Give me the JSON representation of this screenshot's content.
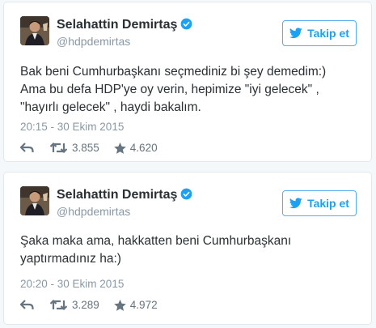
{
  "tweets": [
    {
      "name": "Selahattin Demirtaş",
      "handle": "@hdpdemirtas",
      "follow_label": "Takip et",
      "text": "Bak beni Cumhurbaşkanı seçmediniz bi şey demedim:)\nAma bu defa HDP'ye oy verin, hepimize \"iyi gelecek\" ,\n\"hayırlı gelecek\" , haydi bakalım.",
      "timestamp": "20:15 - 30 Ekim 2015",
      "retweets": "3.855",
      "likes": "4.620"
    },
    {
      "name": "Selahattin Demirtaş",
      "handle": "@hdpdemirtas",
      "follow_label": "Takip et",
      "text": "Şaka maka ama, hakkatten beni Cumhurbaşkanı\nyaptırmadınız ha:)",
      "timestamp": "20:20 - 30 Ekim 2015",
      "retweets": "3.289",
      "likes": "4.972"
    }
  ],
  "icons": {
    "verified": "verified-badge-icon",
    "follow": "twitter-bird-icon",
    "reply": "reply-icon",
    "retweet": "retweet-icon",
    "like": "star-icon"
  },
  "colors": {
    "accent": "#1da1f2",
    "verified": "#1da1f2",
    "text": "#292f33",
    "muted": "#8899a6"
  }
}
